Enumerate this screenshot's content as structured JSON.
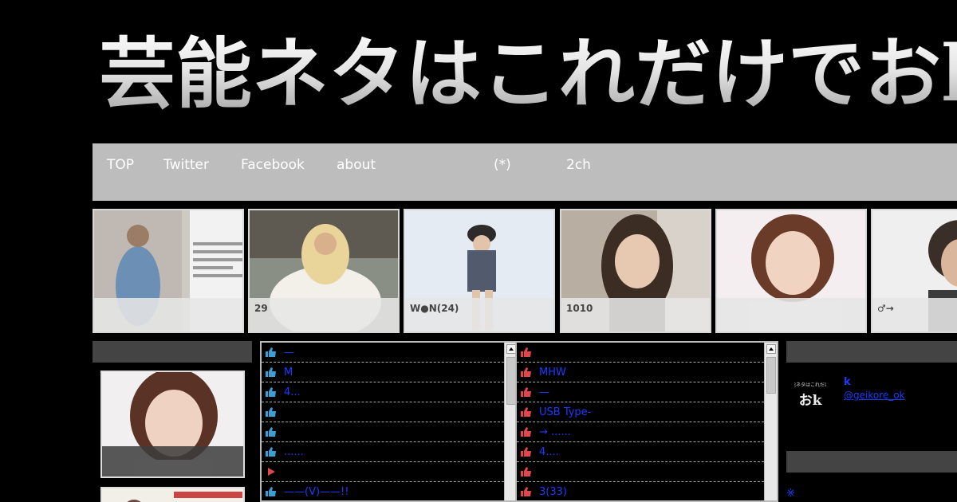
{
  "site": {
    "title": "芸能ネタはこれだけでおk"
  },
  "nav": {
    "items": [
      {
        "label": "TOP"
      },
      {
        "label": "Twitter"
      },
      {
        "label": "Facebook"
      },
      {
        "label": "about"
      },
      {
        "label": "(*)"
      },
      {
        "label": "2ch"
      }
    ]
  },
  "thumbs": [
    {
      "caption": ""
    },
    {
      "caption": "29"
    },
    {
      "caption": "W●N(24)"
    },
    {
      "caption": "1010"
    },
    {
      "caption": ""
    },
    {
      "caption": "♂→"
    }
  ],
  "feed_left": {
    "items": [
      {
        "icon": "thumbs-up-icon",
        "text": "—"
      },
      {
        "icon": "thumbs-up-icon",
        "text": "M"
      },
      {
        "icon": "thumbs-up-icon",
        "text": "4..."
      },
      {
        "icon": "thumbs-up-icon",
        "text": ""
      },
      {
        "icon": "thumbs-up-icon",
        "text": ""
      },
      {
        "icon": "thumbs-up-icon",
        "text": "......"
      },
      {
        "icon": "play-arrow-icon",
        "text": ""
      },
      {
        "icon": "thumbs-up-icon",
        "text": "——(V)——!!"
      }
    ]
  },
  "feed_right": {
    "items": [
      {
        "icon": "thumbs-up-icon",
        "text": ""
      },
      {
        "icon": "thumbs-up-icon",
        "text": "MHW"
      },
      {
        "icon": "thumbs-up-icon",
        "text": "—"
      },
      {
        "icon": "thumbs-up-icon",
        "text": "USB Type-"
      },
      {
        "icon": "thumbs-up-icon",
        "text": "→ ......"
      },
      {
        "icon": "thumbs-up-icon",
        "text": "4...."
      },
      {
        "icon": "thumbs-up-icon",
        "text": ""
      },
      {
        "icon": "thumbs-up-icon",
        "text": "3(33)"
      }
    ]
  },
  "profile": {
    "logo_text": "芸能ネタはこれだけで",
    "logo_big": "おk",
    "name": "k",
    "handle": "@geikore_ok"
  },
  "right_note": "※",
  "colors": {
    "background": "#000000",
    "nav_bg": "#bdbdbd",
    "link_blue": "#1a3cff",
    "icon_blue": "#3b9fd6",
    "icon_red": "#e0474c",
    "section_head": "#444444"
  }
}
